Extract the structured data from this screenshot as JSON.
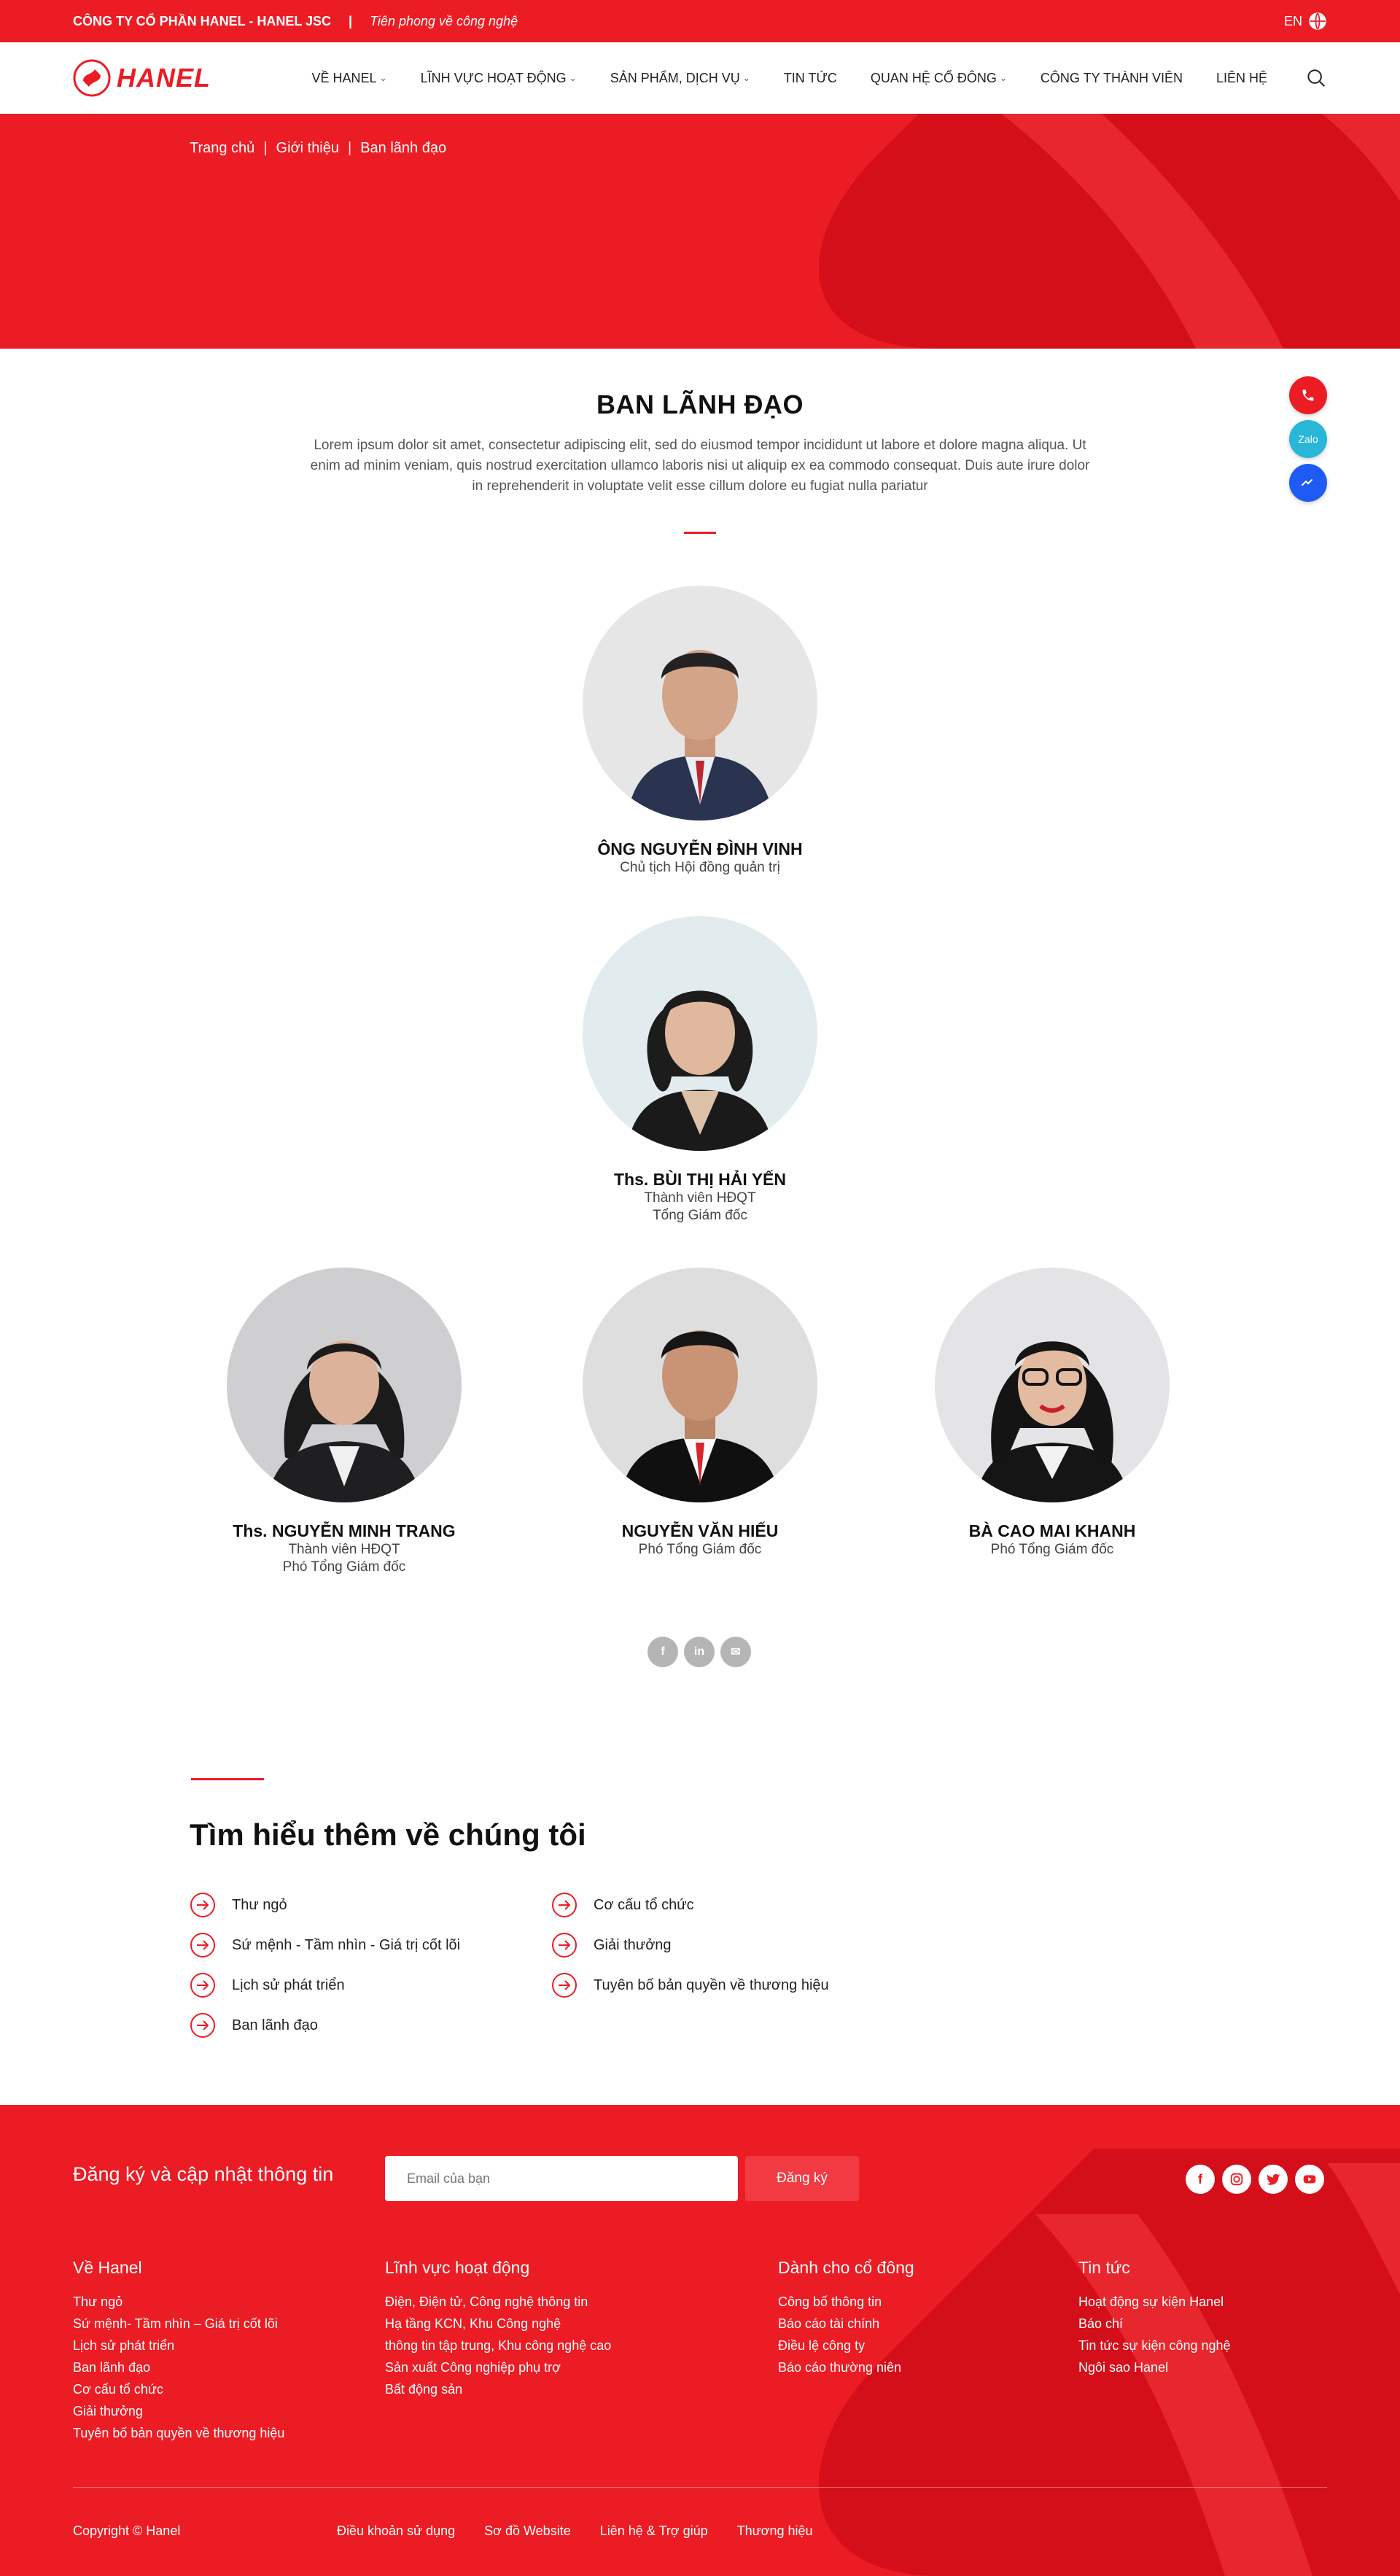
{
  "topbar": {
    "company": "CÔNG TY CỔ PHẦN HANEL - HANEL JSC",
    "separator": "|",
    "slogan": "Tiên phong về công nghệ",
    "lang": "EN"
  },
  "header": {
    "logo_text": "HANEL",
    "nav": [
      {
        "label": "VỀ HANEL",
        "has_dropdown": true
      },
      {
        "label": "LĨNH VỰC HOẠT ĐỘNG",
        "has_dropdown": true
      },
      {
        "label": "SẢN PHẨM, DỊCH VỤ",
        "has_dropdown": true
      },
      {
        "label": "TIN TỨC",
        "has_dropdown": false
      },
      {
        "label": "QUAN HỆ CỔ ĐÔNG",
        "has_dropdown": true
      },
      {
        "label": "CÔNG TY THÀNH VIÊN",
        "has_dropdown": false
      },
      {
        "label": "LIÊN HỆ",
        "has_dropdown": false
      }
    ]
  },
  "breadcrumb": [
    "Trang chủ",
    "Giới thiệu",
    "Ban lãnh đạo"
  ],
  "floating": {
    "zalo": "Zalo"
  },
  "main": {
    "title": "BAN LÃNH ĐẠO",
    "intro": "Lorem ipsum dolor sit amet, consectetur adipiscing elit, sed do eiusmod tempor incididunt ut labore et dolore magna aliqua. Ut enim ad minim veniam, quis nostrud exercitation ullamco laboris nisi ut aliquip ex ea commodo consequat. Duis aute irure dolor in reprehenderit in voluptate velit esse cillum dolore eu fugiat nulla pariatur",
    "leaders": [
      {
        "name": "ÔNG NGUYỄN ĐÌNH VINH",
        "roles": [
          "Chủ tịch Hội đồng quản trị"
        ]
      },
      {
        "name": "Ths. BÙI THỊ HẢI YẾN",
        "roles": [
          "Thành viên HĐQT",
          "Tổng Giám đốc"
        ]
      },
      {
        "name": "Ths. NGUYỄN MINH TRANG",
        "roles": [
          "Thành viên HĐQT",
          "Phó Tổng Giám đốc"
        ]
      },
      {
        "name": "NGUYỄN VĂN HIẾU",
        "roles": [
          "Phó Tổng Giám đốc"
        ]
      },
      {
        "name": "BÀ CAO MAI KHANH",
        "roles": [
          "Phó Tổng Giám đốc"
        ]
      }
    ],
    "share": [
      "f",
      "in",
      "✉"
    ]
  },
  "learn_more": {
    "title": "Tìm hiểu thêm về chúng tôi",
    "links": [
      "Thư ngỏ",
      "Sứ mệnh - Tầm nhìn - Giá trị cốt lõi",
      "Lịch sử phát triển",
      "Ban lãnh đạo",
      "Cơ cấu tổ chức",
      "Giải thưởng",
      "Tuyên bố bản quyền về thương hiệu"
    ]
  },
  "footer": {
    "subscribe_title": "Đăng ký và cập nhật thông tin",
    "email_placeholder": "Email của bạn",
    "subscribe_button": "Đăng ký",
    "columns": [
      {
        "heading": "Về Hanel",
        "items": [
          "Thư ngỏ",
          "Sứ mệnh- Tầm nhìn – Giá trị cốt lõi",
          "Lịch sử phát triển",
          "Ban lãnh đạo",
          "Cơ cấu tổ chức",
          "Giải thưởng",
          "Tuyên bố bản quyền về thương hiệu"
        ]
      },
      {
        "heading": "Lĩnh vực hoạt động",
        "items": [
          "Điện, Điện tử, Công nghệ thông tin",
          "Hạ tầng KCN, Khu Công nghệ",
          "thông tin tập trung, Khu công nghệ cao",
          "Sản xuất Công nghiệp phụ trợ",
          "Bất động sản"
        ]
      },
      {
        "heading": "Dành cho cổ đông",
        "items": [
          "Công bố thông tin",
          "Báo cáo tài chính",
          "Điều lệ công ty",
          "Báo cáo thường niên"
        ]
      },
      {
        "heading": "Tin tức",
        "items": [
          "Hoạt động sự kiện Hanel",
          "Báo chí",
          "Tin tức sự kiện công nghệ",
          "Ngôi sao Hanel"
        ]
      }
    ],
    "copyright": "Copyright © Hanel",
    "bottom_links": [
      "Điều khoản sử dụng",
      "Sơ đồ Website",
      "Liên hệ & Trợ giúp",
      "Thương hiệu"
    ]
  },
  "colors": {
    "brand_red": "#ec1c24",
    "dark_red": "#c8101a",
    "zalo": "#29b6d8",
    "messenger": "#1e5bf5"
  }
}
